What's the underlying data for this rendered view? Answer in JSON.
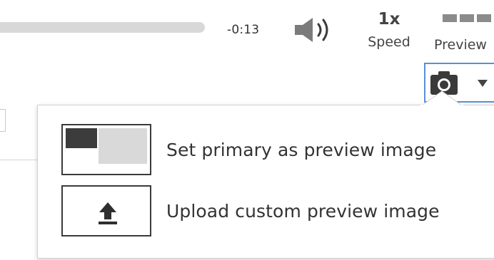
{
  "player": {
    "progress_fraction": 1.0,
    "time_remaining": "-0:13",
    "volume_icon": "speaker-icon",
    "speed": {
      "value": "1x",
      "label": "Speed"
    },
    "preview": {
      "icon": "preview-squares-icon",
      "label": "Preview"
    }
  },
  "camera_dropdown": {
    "icon": "camera-icon",
    "caret_icon": "caret-down-icon",
    "accent_color": "#5a8fd6",
    "items": [
      {
        "icon": "primary-preview-thumbnail-icon",
        "label": "Set primary as preview image"
      },
      {
        "icon": "upload-icon",
        "label": "Upload custom preview image"
      }
    ]
  }
}
